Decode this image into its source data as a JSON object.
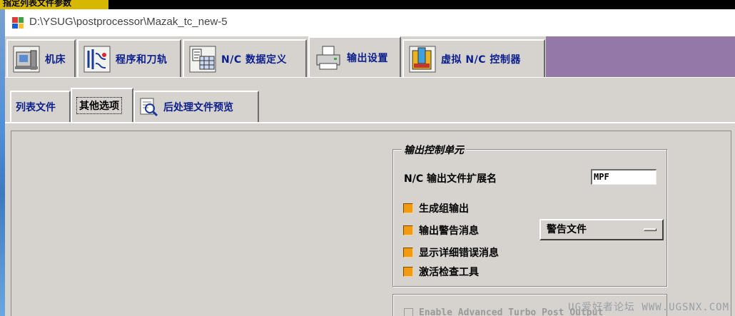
{
  "top_strip": {
    "title": "指定列表文件参数"
  },
  "window": {
    "path": "D:\\YSUG\\postprocessor\\Mazak_tc_new-5"
  },
  "main_tabs": [
    {
      "label": "机床",
      "icon": "machine-icon"
    },
    {
      "label": "程序和刀轨",
      "icon": "program-toolpath-icon"
    },
    {
      "label": "N/C 数据定义",
      "icon": "nc-data-icon"
    },
    {
      "label": "输出设置",
      "icon": "printer-icon",
      "active": true
    },
    {
      "label": "虚拟 N/C 控制器",
      "icon": "virtual-controller-icon"
    }
  ],
  "sub_tabs": [
    {
      "label": "列表文件"
    },
    {
      "label": "其他选项",
      "active": true
    },
    {
      "label": "后处理文件预览",
      "icon": "magnifier-icon"
    }
  ],
  "output_control": {
    "group_title": "输出控制单元",
    "extension_label": "N/C 输出文件扩展名",
    "extension_value": "MPF",
    "options": [
      {
        "label": "生成组输出",
        "checked": true
      },
      {
        "label": "输出警告消息",
        "checked": true
      },
      {
        "label": "显示详细错误消息",
        "checked": true
      },
      {
        "label": "激活检查工具",
        "checked": true
      }
    ],
    "warning_dropdown": "警告文件"
  },
  "turbo": {
    "label": "Enable Advanced Turbo Post Output"
  },
  "watermark": "UG爱好者论坛 WWW.UGSNX.COM",
  "colors": {
    "accent_tab_text": "#0a1e8c",
    "checkbox": "#f29a10",
    "tab_strip": "#9378a8"
  }
}
